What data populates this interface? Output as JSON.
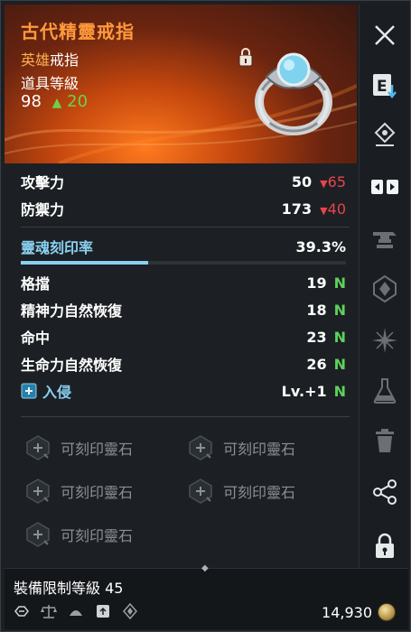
{
  "item": {
    "name": "古代精靈戒指",
    "rarity_prefix": "英雄",
    "rarity_suffix": "戒指",
    "item_level_label": "道具等級",
    "item_level": "98",
    "item_level_up": "20"
  },
  "stats": {
    "attack_label": "攻擊力",
    "attack_value": "50",
    "attack_diff": "65",
    "defense_label": "防禦力",
    "defense_value": "173",
    "defense_diff": "40",
    "soul_label": "靈魂刻印率",
    "soul_value": "39.3%",
    "soul_fraction": 0.393,
    "sub": [
      {
        "label": "格擋",
        "value": "19",
        "badge": "N"
      },
      {
        "label": "精神力自然恢復",
        "value": "18",
        "badge": "N"
      },
      {
        "label": "命中",
        "value": "23",
        "badge": "N"
      },
      {
        "label": "生命力自然恢復",
        "value": "26",
        "badge": "N"
      }
    ],
    "invade_label": "入侵",
    "invade_value": "Lv.+1",
    "invade_badge": "N"
  },
  "sockets": [
    {
      "label": "可刻印靈石"
    },
    {
      "label": "可刻印靈石"
    },
    {
      "label": "可刻印靈石"
    },
    {
      "label": "可刻印靈石"
    },
    {
      "label": "可刻印靈石"
    }
  ],
  "footer": {
    "requirement": "裝備限制等級 45",
    "price": "14,930"
  },
  "sidebar": {
    "equip_key": "E"
  },
  "colors": {
    "accent_orange": "#ff9a3c",
    "down_red": "#e8444b",
    "up_green": "#6ed04a",
    "soul_blue": "#8ad0f0"
  }
}
